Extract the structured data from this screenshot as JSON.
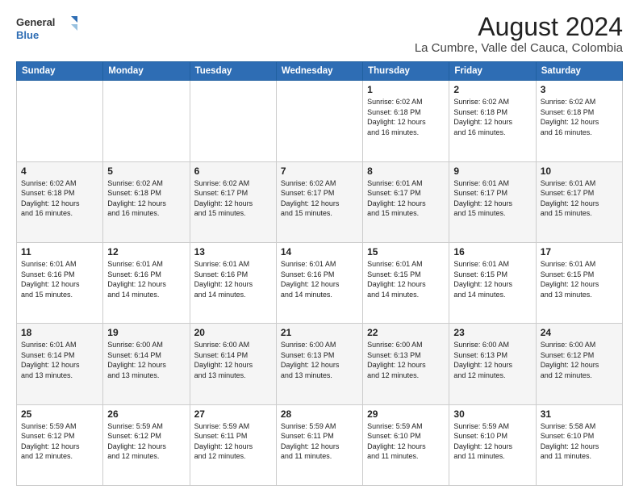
{
  "header": {
    "logo_line1": "General",
    "logo_line2": "Blue",
    "title": "August 2024",
    "subtitle": "La Cumbre, Valle del Cauca, Colombia"
  },
  "weekdays": [
    "Sunday",
    "Monday",
    "Tuesday",
    "Wednesday",
    "Thursday",
    "Friday",
    "Saturday"
  ],
  "weeks": [
    [
      {
        "day": "",
        "info": ""
      },
      {
        "day": "",
        "info": ""
      },
      {
        "day": "",
        "info": ""
      },
      {
        "day": "",
        "info": ""
      },
      {
        "day": "1",
        "info": "Sunrise: 6:02 AM\nSunset: 6:18 PM\nDaylight: 12 hours\nand 16 minutes."
      },
      {
        "day": "2",
        "info": "Sunrise: 6:02 AM\nSunset: 6:18 PM\nDaylight: 12 hours\nand 16 minutes."
      },
      {
        "day": "3",
        "info": "Sunrise: 6:02 AM\nSunset: 6:18 PM\nDaylight: 12 hours\nand 16 minutes."
      }
    ],
    [
      {
        "day": "4",
        "info": "Sunrise: 6:02 AM\nSunset: 6:18 PM\nDaylight: 12 hours\nand 16 minutes."
      },
      {
        "day": "5",
        "info": "Sunrise: 6:02 AM\nSunset: 6:18 PM\nDaylight: 12 hours\nand 16 minutes."
      },
      {
        "day": "6",
        "info": "Sunrise: 6:02 AM\nSunset: 6:17 PM\nDaylight: 12 hours\nand 15 minutes."
      },
      {
        "day": "7",
        "info": "Sunrise: 6:02 AM\nSunset: 6:17 PM\nDaylight: 12 hours\nand 15 minutes."
      },
      {
        "day": "8",
        "info": "Sunrise: 6:01 AM\nSunset: 6:17 PM\nDaylight: 12 hours\nand 15 minutes."
      },
      {
        "day": "9",
        "info": "Sunrise: 6:01 AM\nSunset: 6:17 PM\nDaylight: 12 hours\nand 15 minutes."
      },
      {
        "day": "10",
        "info": "Sunrise: 6:01 AM\nSunset: 6:17 PM\nDaylight: 12 hours\nand 15 minutes."
      }
    ],
    [
      {
        "day": "11",
        "info": "Sunrise: 6:01 AM\nSunset: 6:16 PM\nDaylight: 12 hours\nand 15 minutes."
      },
      {
        "day": "12",
        "info": "Sunrise: 6:01 AM\nSunset: 6:16 PM\nDaylight: 12 hours\nand 14 minutes."
      },
      {
        "day": "13",
        "info": "Sunrise: 6:01 AM\nSunset: 6:16 PM\nDaylight: 12 hours\nand 14 minutes."
      },
      {
        "day": "14",
        "info": "Sunrise: 6:01 AM\nSunset: 6:16 PM\nDaylight: 12 hours\nand 14 minutes."
      },
      {
        "day": "15",
        "info": "Sunrise: 6:01 AM\nSunset: 6:15 PM\nDaylight: 12 hours\nand 14 minutes."
      },
      {
        "day": "16",
        "info": "Sunrise: 6:01 AM\nSunset: 6:15 PM\nDaylight: 12 hours\nand 14 minutes."
      },
      {
        "day": "17",
        "info": "Sunrise: 6:01 AM\nSunset: 6:15 PM\nDaylight: 12 hours\nand 13 minutes."
      }
    ],
    [
      {
        "day": "18",
        "info": "Sunrise: 6:01 AM\nSunset: 6:14 PM\nDaylight: 12 hours\nand 13 minutes."
      },
      {
        "day": "19",
        "info": "Sunrise: 6:00 AM\nSunset: 6:14 PM\nDaylight: 12 hours\nand 13 minutes."
      },
      {
        "day": "20",
        "info": "Sunrise: 6:00 AM\nSunset: 6:14 PM\nDaylight: 12 hours\nand 13 minutes."
      },
      {
        "day": "21",
        "info": "Sunrise: 6:00 AM\nSunset: 6:13 PM\nDaylight: 12 hours\nand 13 minutes."
      },
      {
        "day": "22",
        "info": "Sunrise: 6:00 AM\nSunset: 6:13 PM\nDaylight: 12 hours\nand 12 minutes."
      },
      {
        "day": "23",
        "info": "Sunrise: 6:00 AM\nSunset: 6:13 PM\nDaylight: 12 hours\nand 12 minutes."
      },
      {
        "day": "24",
        "info": "Sunrise: 6:00 AM\nSunset: 6:12 PM\nDaylight: 12 hours\nand 12 minutes."
      }
    ],
    [
      {
        "day": "25",
        "info": "Sunrise: 5:59 AM\nSunset: 6:12 PM\nDaylight: 12 hours\nand 12 minutes."
      },
      {
        "day": "26",
        "info": "Sunrise: 5:59 AM\nSunset: 6:12 PM\nDaylight: 12 hours\nand 12 minutes."
      },
      {
        "day": "27",
        "info": "Sunrise: 5:59 AM\nSunset: 6:11 PM\nDaylight: 12 hours\nand 12 minutes."
      },
      {
        "day": "28",
        "info": "Sunrise: 5:59 AM\nSunset: 6:11 PM\nDaylight: 12 hours\nand 11 minutes."
      },
      {
        "day": "29",
        "info": "Sunrise: 5:59 AM\nSunset: 6:10 PM\nDaylight: 12 hours\nand 11 minutes."
      },
      {
        "day": "30",
        "info": "Sunrise: 5:59 AM\nSunset: 6:10 PM\nDaylight: 12 hours\nand 11 minutes."
      },
      {
        "day": "31",
        "info": "Sunrise: 5:58 AM\nSunset: 6:10 PM\nDaylight: 12 hours\nand 11 minutes."
      }
    ]
  ]
}
